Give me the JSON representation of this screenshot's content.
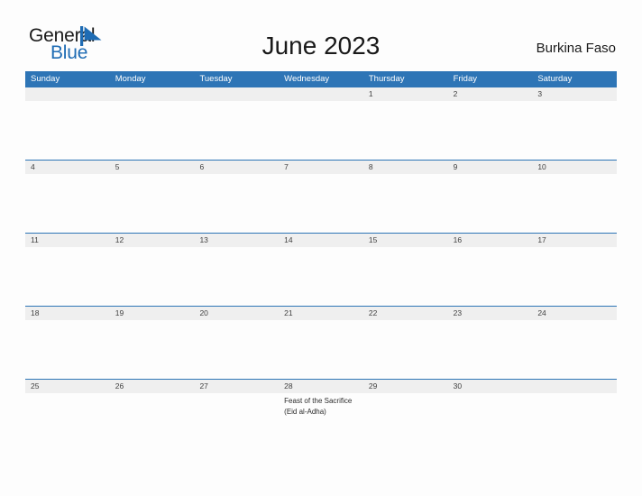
{
  "brand": {
    "name_part1": "General",
    "name_part2": "Blue",
    "flag_color": "#1f6cb4",
    "text_color": "#1a1a1a"
  },
  "header": {
    "title": "June 2023",
    "region": "Burkina Faso"
  },
  "theme": {
    "header_blue": "#2e75b6",
    "band_gray": "#efefef",
    "page_background": "#fdfdfd",
    "date_text": "#404040"
  },
  "calendar": {
    "weekdays": [
      "Sunday",
      "Monday",
      "Tuesday",
      "Wednesday",
      "Thursday",
      "Friday",
      "Saturday"
    ],
    "weeks": [
      {
        "dates": [
          "",
          "",
          "",
          "",
          "1",
          "2",
          "3"
        ],
        "events": [
          "",
          "",
          "",
          "",
          "",
          "",
          ""
        ]
      },
      {
        "dates": [
          "4",
          "5",
          "6",
          "7",
          "8",
          "9",
          "10"
        ],
        "events": [
          "",
          "",
          "",
          "",
          "",
          "",
          ""
        ]
      },
      {
        "dates": [
          "11",
          "12",
          "13",
          "14",
          "15",
          "16",
          "17"
        ],
        "events": [
          "",
          "",
          "",
          "",
          "",
          "",
          ""
        ]
      },
      {
        "dates": [
          "18",
          "19",
          "20",
          "21",
          "22",
          "23",
          "24"
        ],
        "events": [
          "",
          "",
          "",
          "",
          "",
          "",
          ""
        ]
      },
      {
        "dates": [
          "25",
          "26",
          "27",
          "28",
          "29",
          "30",
          ""
        ],
        "events": [
          "",
          "",
          "",
          "Feast of the Sacrifice (Eid al-Adha)",
          "",
          "",
          ""
        ]
      }
    ]
  }
}
